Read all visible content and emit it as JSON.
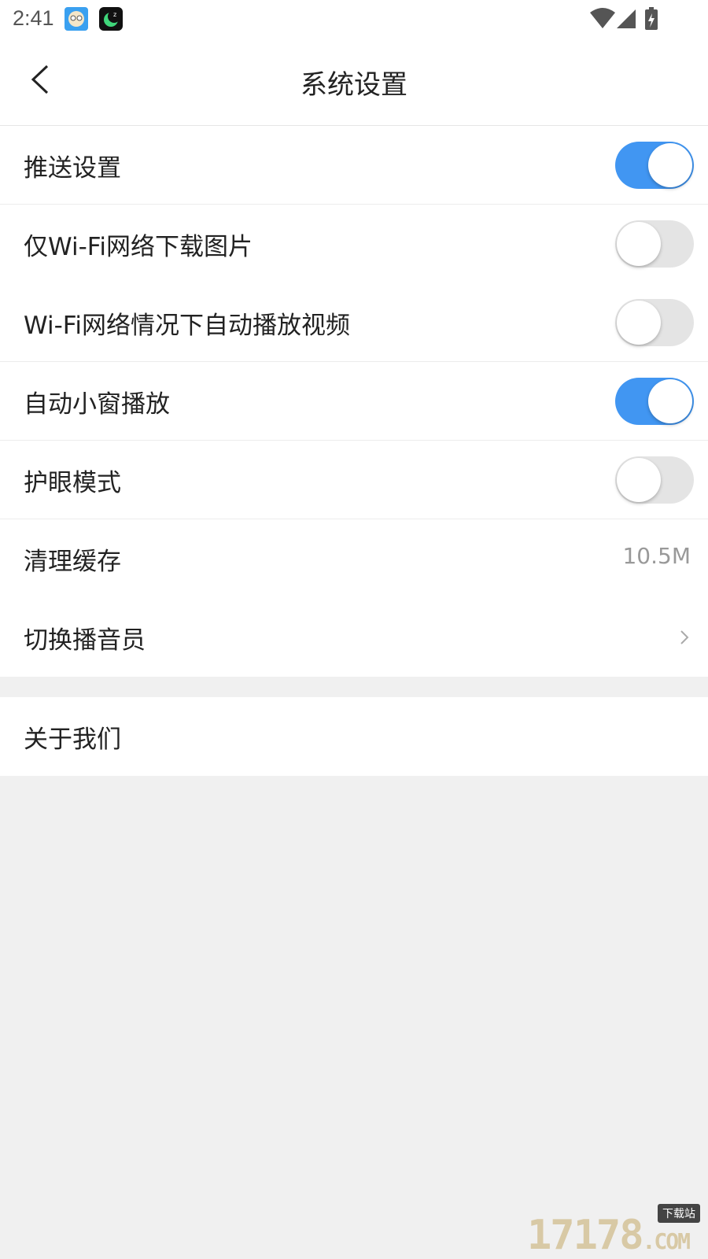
{
  "status_bar": {
    "time": "2:41"
  },
  "header": {
    "title": "系统设置"
  },
  "settings": [
    {
      "label": "推送设置",
      "control": "toggle",
      "state": "on"
    },
    {
      "label": "仅Wi-Fi网络下载图片",
      "control": "toggle",
      "state": "off"
    },
    {
      "label": "Wi-Fi网络情况下自动播放视频",
      "control": "toggle",
      "state": "off"
    },
    {
      "label": "自动小窗播放",
      "control": "toggle",
      "state": "on"
    },
    {
      "label": "护眼模式",
      "control": "toggle",
      "state": "off"
    },
    {
      "label": "清理缓存",
      "control": "value",
      "value": "10.5M"
    },
    {
      "label": "切换播音员",
      "control": "chevron"
    }
  ],
  "about": {
    "label": "关于我们"
  },
  "watermark": {
    "text": "17178",
    "badge": "下载站",
    "suffix": ".COM"
  },
  "colors": {
    "toggle_on": "#4196f2",
    "toggle_off": "#e4e4e4",
    "page_bg": "#f0f0f0"
  }
}
